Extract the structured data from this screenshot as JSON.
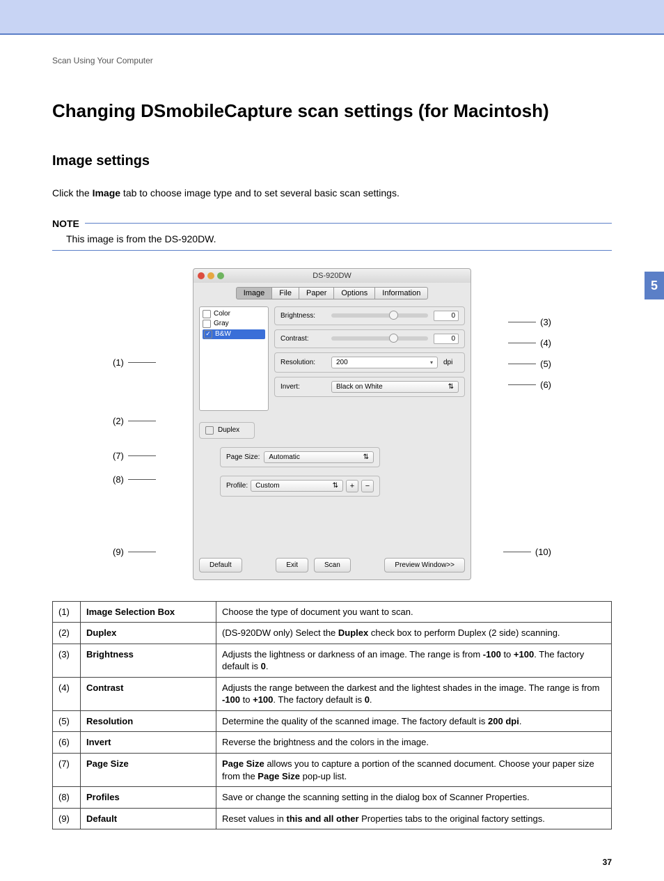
{
  "breadcrumb": "Scan Using Your Computer",
  "page_title": "Changing DSmobileCapture scan settings (for Macintosh)",
  "chapter_tab": "5",
  "page_number": "37",
  "section": {
    "title": "Image settings",
    "intro_pre": "Click the ",
    "intro_bold": "Image",
    "intro_post": " tab to choose image type and to set several basic scan settings."
  },
  "note": {
    "label": "NOTE",
    "text": "This image is from the DS-920DW."
  },
  "screenshot": {
    "window_title": "DS-920DW",
    "tabs": [
      "Image",
      "File",
      "Paper",
      "Options",
      "Information"
    ],
    "image_selection": {
      "items": [
        {
          "label": "Color",
          "checked": false
        },
        {
          "label": "Gray",
          "checked": false
        },
        {
          "label": "B&W",
          "checked": true
        }
      ]
    },
    "brightness": {
      "label": "Brightness:",
      "value": "0"
    },
    "contrast": {
      "label": "Contrast:",
      "value": "0"
    },
    "resolution": {
      "label": "Resolution:",
      "value": "200",
      "unit": "dpi"
    },
    "invert": {
      "label": "Invert:",
      "value": "Black on White"
    },
    "duplex": {
      "label": "Duplex"
    },
    "page_size": {
      "label": "Page Size:",
      "value": "Automatic"
    },
    "profile": {
      "label": "Profile:",
      "value": "Custom"
    },
    "buttons": {
      "default": "Default",
      "exit": "Exit",
      "scan": "Scan",
      "preview": "Preview Window>>"
    }
  },
  "callouts": {
    "c1": "(1)",
    "c2": "(2)",
    "c3": "(3)",
    "c4": "(4)",
    "c5": "(5)",
    "c6": "(6)",
    "c7": "(7)",
    "c8": "(8)",
    "c9": "(9)",
    "c10": "(10)"
  },
  "table": [
    {
      "num": "(1)",
      "term": "Image Selection Box",
      "desc_parts": [
        {
          "t": "Choose the type of document you want to scan."
        }
      ]
    },
    {
      "num": "(2)",
      "term": "Duplex",
      "desc_parts": [
        {
          "t": "(DS-920DW only) Select the "
        },
        {
          "b": "Duplex"
        },
        {
          "t": " check box to perform Duplex (2 side) scanning."
        }
      ]
    },
    {
      "num": "(3)",
      "term": "Brightness",
      "desc_parts": [
        {
          "t": "Adjusts the lightness or darkness of an image. The range is from "
        },
        {
          "b": "-100"
        },
        {
          "t": " to "
        },
        {
          "b": "+100"
        },
        {
          "t": ". The factory default is "
        },
        {
          "b": "0"
        },
        {
          "t": "."
        }
      ]
    },
    {
      "num": "(4)",
      "term": "Contrast",
      "desc_parts": [
        {
          "t": "Adjusts the range between the darkest and the lightest shades in the image. The range is from "
        },
        {
          "b": "-100"
        },
        {
          "t": " to "
        },
        {
          "b": "+100"
        },
        {
          "t": ". The factory default is "
        },
        {
          "b": "0"
        },
        {
          "t": "."
        }
      ]
    },
    {
      "num": "(5)",
      "term": "Resolution",
      "desc_parts": [
        {
          "t": "Determine the quality of the scanned image. The factory default is "
        },
        {
          "b": "200 dpi"
        },
        {
          "t": "."
        }
      ]
    },
    {
      "num": "(6)",
      "term": "Invert",
      "desc_parts": [
        {
          "t": "Reverse the brightness and the colors in the image."
        }
      ]
    },
    {
      "num": "(7)",
      "term": "Page Size",
      "desc_parts": [
        {
          "b": "Page Size"
        },
        {
          "t": " allows you to capture a portion of the scanned document. Choose your paper size from the "
        },
        {
          "b": "Page Size"
        },
        {
          "t": " pop-up list."
        }
      ]
    },
    {
      "num": "(8)",
      "term": "Profiles",
      "desc_parts": [
        {
          "t": "Save or change the scanning setting in the dialog box of Scanner Properties."
        }
      ]
    },
    {
      "num": "(9)",
      "term": "Default",
      "desc_parts": [
        {
          "t": "Reset values in "
        },
        {
          "b": "this and all other"
        },
        {
          "t": " Properties tabs to the original factory settings."
        }
      ]
    }
  ]
}
